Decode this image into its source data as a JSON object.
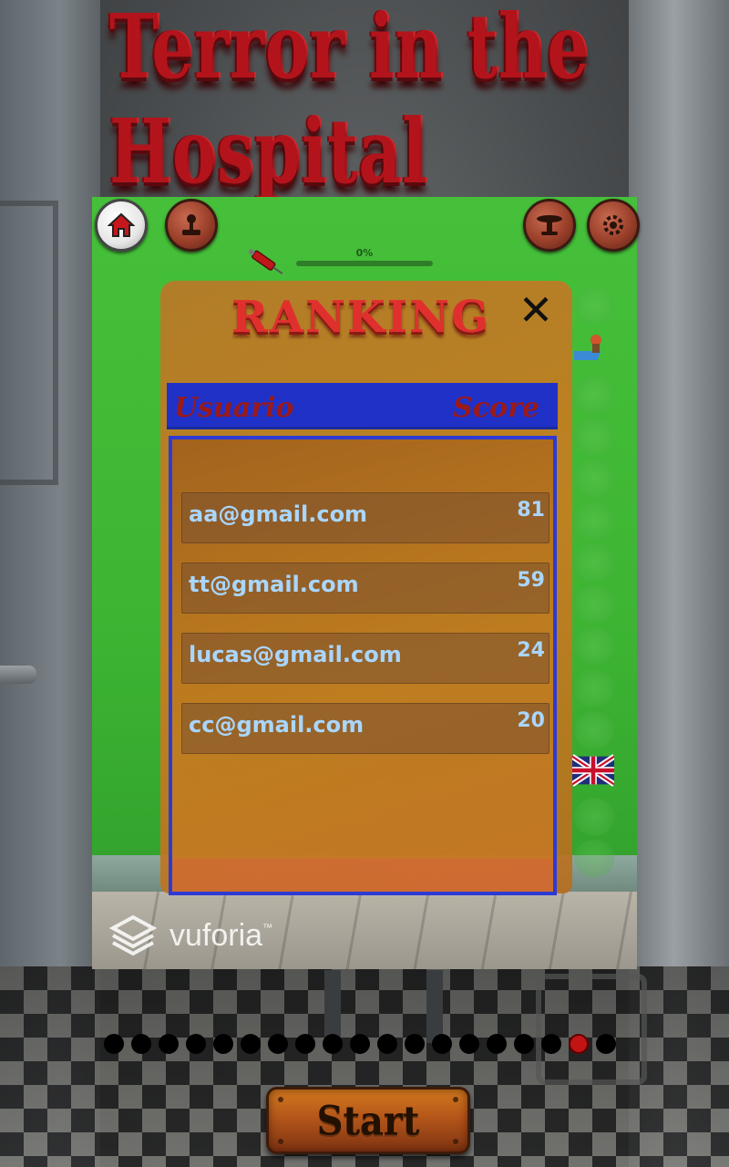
{
  "title": "Terror in the Hospital",
  "toolbar": {
    "home_icon": "home-icon",
    "profile_icon": "joystick-icon",
    "table_icon": "table-icon",
    "settings_icon": "gear-icon"
  },
  "progress": {
    "label": "0%",
    "value": 0
  },
  "ranking": {
    "title": "RANKING",
    "close_label": "✕",
    "header_user": "Usuario",
    "header_score": "Score",
    "rows": [
      {
        "user": "aa@gmail.com",
        "score": "81"
      },
      {
        "user": "tt@gmail.com",
        "score": "59"
      },
      {
        "user": "lucas@gmail.com",
        "score": "24"
      },
      {
        "user": "cc@gmail.com",
        "score": "20"
      }
    ]
  },
  "watermark": {
    "brand": "vuforia",
    "tm": "™"
  },
  "pager": {
    "total": 19,
    "active_index": 17
  },
  "start_button": {
    "label": "Start"
  },
  "colors": {
    "accent": "#b3141c",
    "header_bar": "#1f31c7",
    "list_text": "#a9d6ff",
    "panel_green": "#3db533"
  }
}
